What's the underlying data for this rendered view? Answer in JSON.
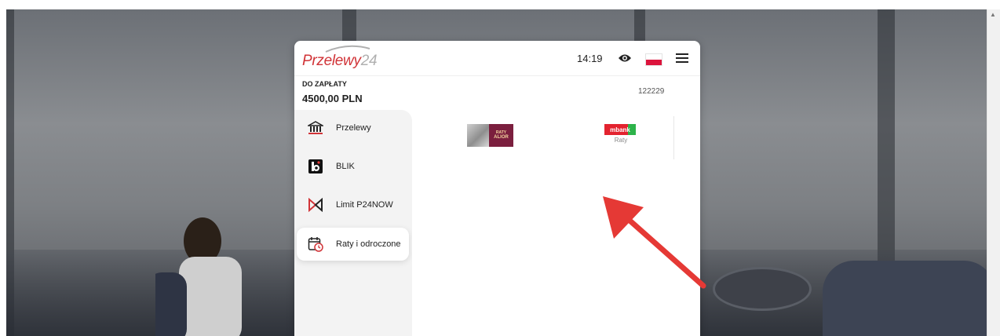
{
  "header": {
    "logo_text": "Przelewy",
    "logo_number": "24",
    "time": "14:19"
  },
  "payment": {
    "amount_label": "DO ZAPŁATY",
    "amount_value": "4500,00 PLN",
    "order_id": "122229"
  },
  "methods": [
    {
      "label": "Przelewy",
      "icon": "bank-icon"
    },
    {
      "label": "BLIK",
      "icon": "blik-icon"
    },
    {
      "label": "Limit P24NOW",
      "icon": "p24now-icon"
    },
    {
      "label": "Raty i odroczone",
      "icon": "calendar-clock-icon",
      "active": true
    }
  ],
  "options": {
    "alior": {
      "line1": "RATY",
      "line2": "ALIOR"
    },
    "mbank": {
      "logo": "mbank",
      "caption": "Raty"
    }
  },
  "colors": {
    "brand": "#d13438",
    "arrow": "#e53935",
    "alior": "#7b1f3e",
    "mbank_red": "#e3232f",
    "mbank_green": "#2db34a"
  }
}
